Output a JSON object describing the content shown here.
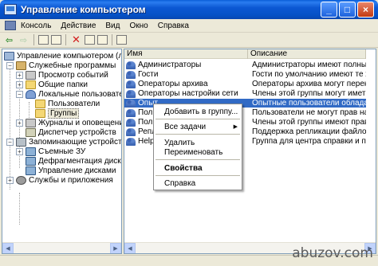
{
  "window": {
    "title": "Управление компьютером",
    "buttons": {
      "minimize": "_",
      "maximize": "□",
      "close": "×"
    }
  },
  "menu": [
    "Консоль",
    "Действие",
    "Вид",
    "Окно",
    "Справка"
  ],
  "toolbar": {
    "icons": [
      "back-arrow-icon",
      "forward-arrow-icon",
      "up-folder-icon",
      "show-tree-icon",
      "delete-icon",
      "properties-icon",
      "export-icon",
      "help-icon"
    ]
  },
  "tree": {
    "root": "Управление компьютером (локаль",
    "items": [
      {
        "label": "Служебные программы",
        "level": 1,
        "expander": "−"
      },
      {
        "label": "Просмотр событий",
        "level": 2,
        "expander": "+"
      },
      {
        "label": "Общие папки",
        "level": 2,
        "expander": "+"
      },
      {
        "label": "Локальные пользователи и",
        "level": 2,
        "expander": "−"
      },
      {
        "label": "Пользователи",
        "level": 3,
        "expander": ""
      },
      {
        "label": "Группы",
        "level": 3,
        "expander": ""
      },
      {
        "label": "Журналы и оповещения пр",
        "level": 2,
        "expander": "+"
      },
      {
        "label": "Диспетчер устройств",
        "level": 2,
        "expander": ""
      },
      {
        "label": "Запоминающие устройства",
        "level": 1,
        "expander": "−"
      },
      {
        "label": "Съемные ЗУ",
        "level": 2,
        "expander": "+"
      },
      {
        "label": "Дефрагментация диска",
        "level": 2,
        "expander": ""
      },
      {
        "label": "Управление дисками",
        "level": 2,
        "expander": ""
      },
      {
        "label": "Службы и приложения",
        "level": 1,
        "expander": "+"
      }
    ]
  },
  "list": {
    "columns": [
      "Имя",
      "Описание"
    ],
    "rows": [
      {
        "name": "Администраторы",
        "desc": "Администраторы имеют полные,"
      },
      {
        "name": "Гости",
        "desc": "Гости по умолчанию имеют те же"
      },
      {
        "name": "Операторы архива",
        "desc": "Операторы архива могут перекры"
      },
      {
        "name": "Операторы настройки сети",
        "desc": "Члены этой группы могут иметь"
      },
      {
        "name": "Опыт",
        "desc": "Опытные пользователи обладаю..."
      },
      {
        "name": "Поль",
        "desc": "Пользователи не могут прав на и"
      },
      {
        "name": "Поль",
        "desc": "Члены этой группы имеют право"
      },
      {
        "name": "Репл",
        "desc": "Поддержка репликации файлов в"
      },
      {
        "name": "HelpS",
        "desc": "Группа для центра справки и под"
      }
    ]
  },
  "context_menu": {
    "items": [
      {
        "label": "Добавить в группу...",
        "bold": false,
        "submenu": false
      },
      {
        "label": "Все задачи",
        "bold": false,
        "submenu": true
      },
      {
        "label": "Удалить",
        "bold": false,
        "submenu": false
      },
      {
        "label": "Переименовать",
        "bold": false,
        "submenu": false
      },
      {
        "label": "Свойства",
        "bold": true,
        "submenu": false
      },
      {
        "label": "Справка",
        "bold": false,
        "submenu": false
      }
    ]
  },
  "watermark": "abuzov.com",
  "colors": {
    "titlebar": "#0551c6",
    "selection": "#316ac5",
    "chrome": "#ece9d8"
  }
}
